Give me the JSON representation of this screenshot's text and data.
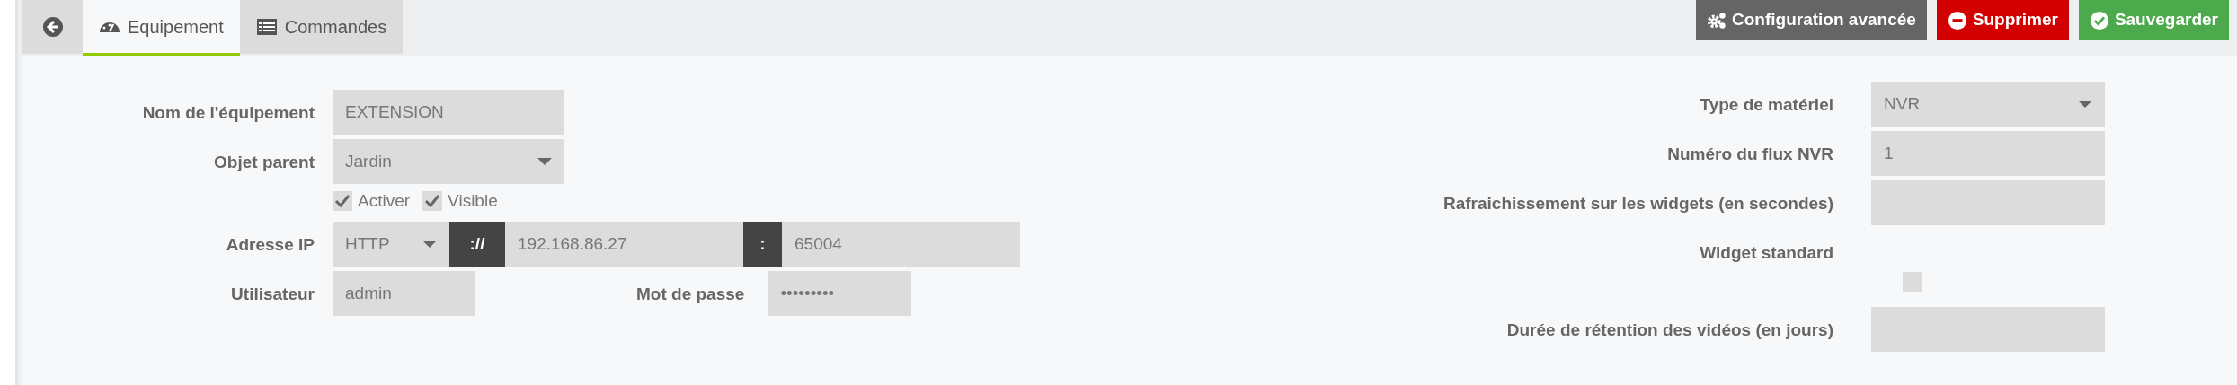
{
  "back_tab": {
    "kind": "back"
  },
  "tabs": [
    {
      "label": "Equipement",
      "kind": "gauge",
      "selected": true
    },
    {
      "label": "Commandes",
      "kind": "list",
      "selected": false
    }
  ],
  "buttons": [
    {
      "label": "Configuration avancée",
      "kind": "config"
    },
    {
      "label": "Supprimer",
      "kind": "delete"
    },
    {
      "label": "Sauvegarder",
      "kind": "save"
    }
  ],
  "form_left": {
    "name": {
      "label": "Nom de l'équipement",
      "value": "EXTENSION"
    },
    "parent": {
      "label": "Objet parent",
      "value": "Jardin"
    },
    "options": [
      {
        "label": "Activer",
        "checked": true
      },
      {
        "label": "Visible",
        "checked": true
      }
    ],
    "ip": {
      "label": "Adresse IP",
      "protocol": "HTTP",
      "separator": "://",
      "host": "192.168.86.27",
      "port_separator": ":",
      "port": "65004"
    },
    "user": {
      "label": "Utilisateur",
      "value": "admin"
    },
    "password": {
      "label": "Mot de passe",
      "value": "•••••••••"
    }
  },
  "form_right": [
    {
      "label": "Type de matériel",
      "kind": "select",
      "value": "NVR"
    },
    {
      "label": "Numéro du flux NVR",
      "kind": "text",
      "value": "1"
    },
    {
      "label": "Rafraichissement sur les widgets (en secondes)",
      "kind": "text"
    },
    {
      "label": "Widget standard",
      "kind": "checkbox",
      "checked": false
    },
    {
      "label": "Durée de rétention des vidéos (en jours)",
      "kind": "text"
    }
  ]
}
